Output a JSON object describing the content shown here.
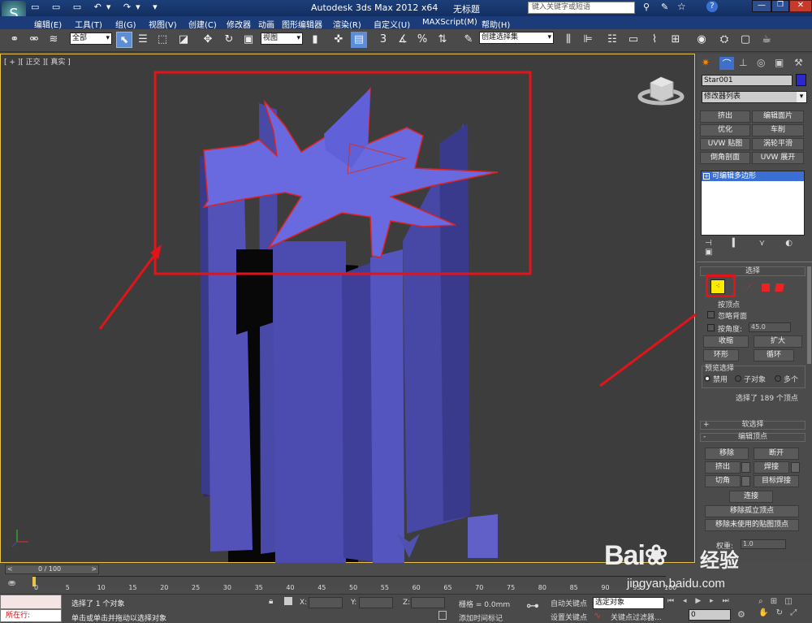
{
  "title": {
    "app": "Autodesk 3ds Max  2012 x64",
    "doc": "无标题",
    "search_placeholder": "键入关键字或短语"
  },
  "menu": [
    "编辑(E)",
    "工具(T)",
    "组(G)",
    "视图(V)",
    "创建(C)",
    "修改器",
    "动画",
    "图形编辑器",
    "渲染(R)",
    "自定义(U)",
    "MAXScript(M)",
    "帮助(H)"
  ],
  "toolbar": {
    "filter": "全部",
    "refcoord": "视图",
    "selset": "创建选择集",
    "snap_label": "3",
    "percent": "%"
  },
  "viewport": {
    "label": "[ + ][ 正交 ][ 真实 ]"
  },
  "cmdpanel": {
    "object_name": "Star001",
    "modifier_list": "修改器列表",
    "mod_buttons": [
      "挤出",
      "编辑面片",
      "优化",
      "车削",
      "UVW 贴图",
      "涡轮平滑",
      "倒角剖面",
      "UVW 展开"
    ],
    "stack_item": "可编辑多边形",
    "selection_title": "选择",
    "by_vertex": "按顶点",
    "ignore_backface": "忽略背面",
    "by_angle": "按角度:",
    "angle_value": "45.0",
    "shrink": "收缩",
    "grow": "扩大",
    "ring": "环形",
    "loop": "循环",
    "preview_title": "预览选择",
    "preview_opts": [
      "禁用",
      "子对象",
      "多个"
    ],
    "selected_info": "选择了 189 个顶点",
    "soft_sel": "软选择",
    "edit_vertices": "编辑顶点",
    "remove": "移除",
    "break": "断开",
    "extrude": "挤出",
    "weld": "焊接",
    "chamfer": "切角",
    "target_weld": "目标焊接",
    "connect": "连接",
    "remove_isolated": "移除孤立顶点",
    "remove_unused": "移除未使用的贴图顶点",
    "weight_label": "权重:",
    "weight_value": "1.0"
  },
  "timeline": {
    "frame": "0 / 100",
    "ticks": [
      "0",
      "5",
      "10",
      "15",
      "20",
      "25",
      "30",
      "35",
      "40",
      "45",
      "50",
      "55",
      "60",
      "65",
      "70",
      "75",
      "80",
      "85",
      "90",
      "95",
      "100"
    ]
  },
  "status": {
    "running": "所在行:",
    "selected": "选择了 1 个对象",
    "hint": "单击或单击并拖动以选择对象",
    "x": "X:",
    "y": "Y:",
    "z": "Z:",
    "grid": "栅格 = 0.0mm",
    "add_tag": "添加时间标记",
    "autokey": "自动关键点",
    "setkey": "设置关键点",
    "selobj": "选定对象",
    "keyfilter": "关键点过滤器...",
    "frame_val": "0"
  },
  "watermark": {
    "brand": "Bai",
    "brand2": "经验",
    "url": "jingyan.baidu.com"
  }
}
